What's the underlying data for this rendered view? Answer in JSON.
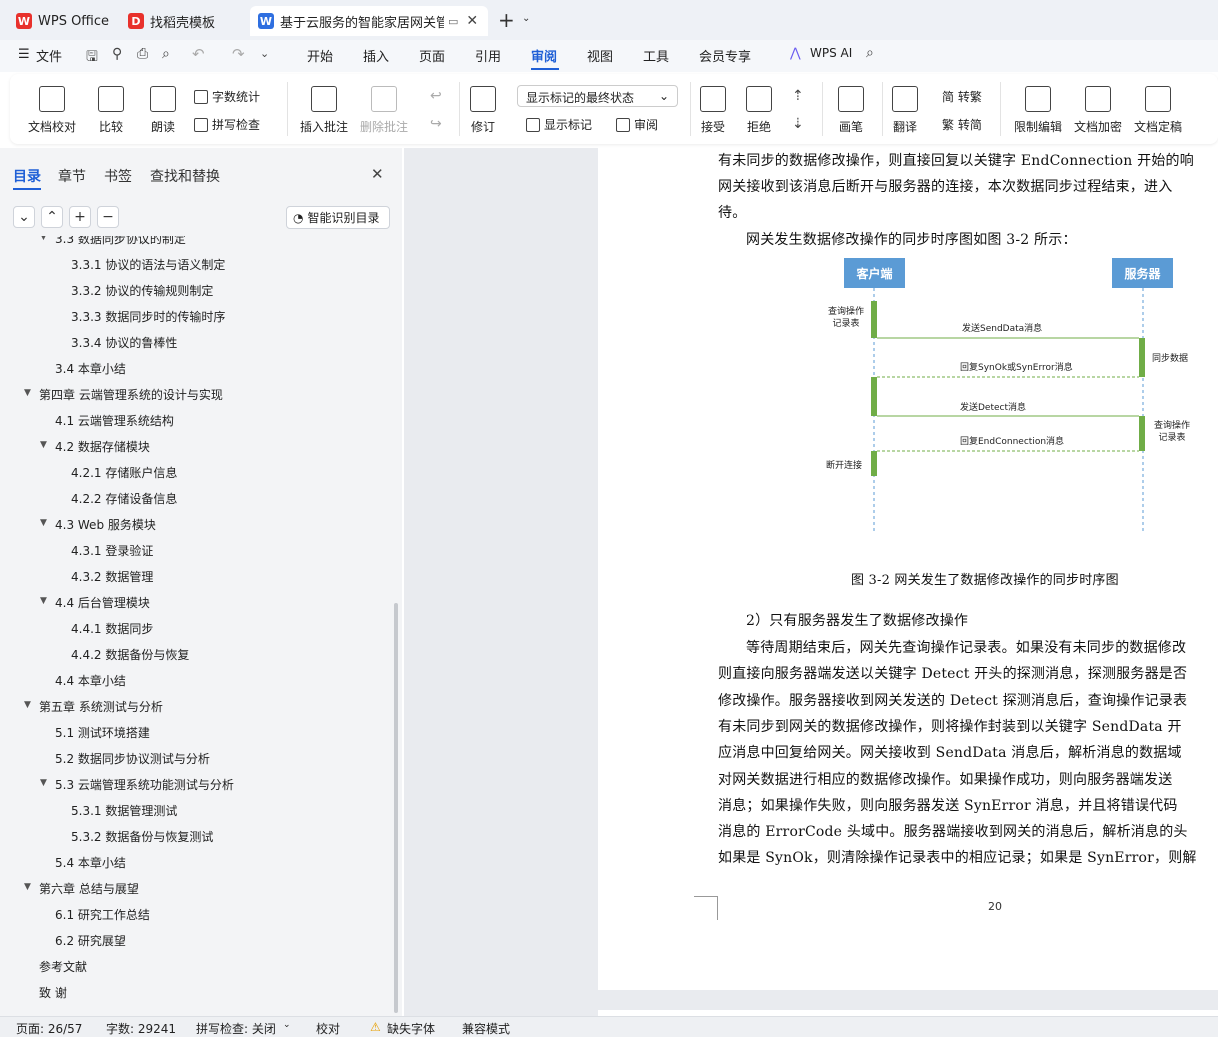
{
  "tabs": [
    {
      "label": "WPS Office"
    },
    {
      "label": "找稻壳模板"
    },
    {
      "label": "基于云服务的智能家居网关管"
    }
  ],
  "menu": {
    "file": "文件",
    "items": [
      "开始",
      "插入",
      "页面",
      "引用",
      "审阅",
      "视图",
      "工具",
      "会员专享"
    ],
    "ai": "WPS AI"
  },
  "ribbon": {
    "proofread": "文档校对",
    "compare": "比较",
    "read_aloud": "朗读",
    "word_count": "字数统计",
    "spell_check": "拼写检查",
    "insert_comment": "插入批注",
    "delete_comment": "删除批注",
    "revise": "修订",
    "markup_dropdown": "显示标记的最终状态",
    "show_markup": "显示标记",
    "review": "审阅",
    "accept": "接受",
    "reject": "拒绝",
    "pen": "画笔",
    "translate": "翻译",
    "to_trad": "简 转繁",
    "to_simp": "繁 转简",
    "restrict": "限制编辑",
    "encrypt": "文档加密",
    "finalize": "文档定稿"
  },
  "leftpanel": {
    "tabs": [
      "目录",
      "章节",
      "书签",
      "查找和替换"
    ],
    "smart_toc": "智能识别目录",
    "toc": [
      {
        "text": "3.3  数据同步协议的制定",
        "level": 2
      },
      {
        "text": "3.3.1  协议的语法与语义制定",
        "level": 3
      },
      {
        "text": "3.3.2  协议的传输规则制定",
        "level": 3
      },
      {
        "text": "3.3.3  数据同步时的传输时序",
        "level": 3
      },
      {
        "text": "3.3.4  协议的鲁棒性",
        "level": 3
      },
      {
        "text": "3.4  本章小结",
        "level": 2
      },
      {
        "text": "第四章  云端管理系统的设计与实现",
        "level": 1
      },
      {
        "text": "4.1  云端管理系统结构",
        "level": 2
      },
      {
        "text": "4.2  数据存储模块",
        "level": 2
      },
      {
        "text": "4.2.1  存储账户信息",
        "level": 3
      },
      {
        "text": "4.2.2  存储设备信息",
        "level": 3
      },
      {
        "text": "4.3 Web 服务模块",
        "level": 2
      },
      {
        "text": "4.3.1  登录验证",
        "level": 3
      },
      {
        "text": "4.3.2  数据管理",
        "level": 3
      },
      {
        "text": "4.4  后台管理模块",
        "level": 2
      },
      {
        "text": "4.4.1  数据同步",
        "level": 3
      },
      {
        "text": "4.4.2  数据备份与恢复",
        "level": 3
      },
      {
        "text": "4.4  本章小结",
        "level": 2
      },
      {
        "text": "第五章  系统测试与分析",
        "level": 1
      },
      {
        "text": "5.1  测试环境搭建",
        "level": 2
      },
      {
        "text": "5.2  数据同步协议测试与分析",
        "level": 2
      },
      {
        "text": "5.3  云端管理系统功能测试与分析",
        "level": 2
      },
      {
        "text": "5.3.1  数据管理测试",
        "level": 3
      },
      {
        "text": "5.3.2  数据备份与恢复测试",
        "level": 3
      },
      {
        "text": "5.4  本章小结",
        "level": 2
      },
      {
        "text": "第六章    总结与展望",
        "level": 1
      },
      {
        "text": "6.1  研究工作总结",
        "level": 2
      },
      {
        "text": "6.2  研究展望",
        "level": 2
      },
      {
        "text": "参考文献",
        "level": 1
      },
      {
        "text": "致    谢",
        "level": 1
      }
    ]
  },
  "doc": {
    "lines_top": [
      "有未同步的数据修改操作，则直接回复以关键字 EndConnection 开始的响",
      "网关接收到该消息后断开与服务器的连接，本次数据同步过程结束，进入",
      "待。",
      "网关发生数据修改操作的同步时序图如图 3-2 所示："
    ],
    "diagram": {
      "client": "客户端",
      "server": "服务器",
      "query_log": "查询操作记录表",
      "send_data": "发送SendData消息",
      "sync_data": "同步数据",
      "reply": "回复SynOk或SynError消息",
      "send_detect": "发送Detect消息",
      "server_query": "查询操作记录表",
      "reply_end": "回复EndConnection消息",
      "disconnect": "断开连接"
    },
    "caption": "图 3-2    网关发生了数据修改操作的同步时序图",
    "heading2": "2）只有服务器发生了数据修改操作",
    "lines_bottom": [
      "等待周期结束后，网关先查询操作记录表。如果没有未同步的数据修改",
      "则直接向服务器端发送以关键字 Detect 开头的探测消息，探测服务器是否",
      "修改操作。服务器接收到网关发送的 Detect 探测消息后，查询操作记录表",
      "有未同步到网关的数据修改操作，则将操作封装到以关键字 SendData 开",
      "应消息中回复给网关。网关接收到 SendData 消息后，解析消息的数据域",
      "对网关数据进行相应的数据修改操作。如果操作成功，则向服务器端发送",
      "消息；如果操作失败，则向服务器发送 SynError 消息，并且将错误代码",
      "消息的 ErrorCode 头域中。服务器端接收到网关的消息后，解析消息的头",
      "如果是 SynOk，则清除操作记录表中的相应记录；如果是 SynError，则解"
    ],
    "page_number": "20"
  },
  "status": {
    "page": "页面: 26/57",
    "words": "字数: 29241",
    "spell": "拼写检查: 关闭",
    "proof": "校对",
    "missing_font": "缺失字体",
    "compat": "兼容模式"
  },
  "colors": {
    "accent": "#1f5fd6",
    "lifeline_head": "#5b9bd5",
    "activation": "#70ad47"
  }
}
